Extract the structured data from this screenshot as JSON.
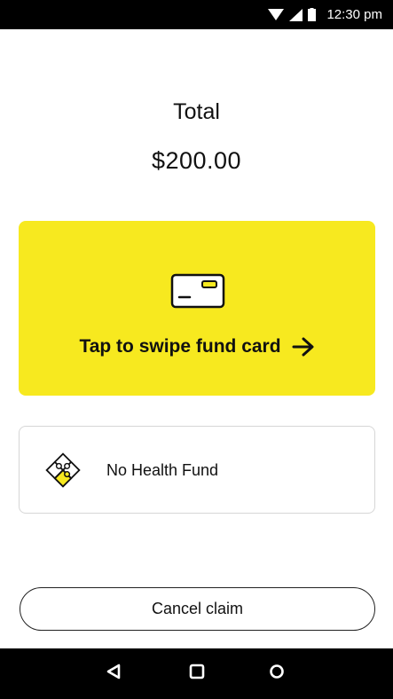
{
  "status_bar": {
    "time": "12:30 pm",
    "icons": [
      "wifi-icon",
      "signal-icon",
      "battery-icon"
    ]
  },
  "total": {
    "label": "Total",
    "amount": "$200.00"
  },
  "swipe_card": {
    "label": "Tap to swipe fund card",
    "icon": "card-icon",
    "arrow_icon": "arrow-right-icon",
    "background_color": "#f7e91f"
  },
  "fund_option": {
    "label": "No Health Fund",
    "icon": "puzzle-icon"
  },
  "cancel": {
    "label": "Cancel claim"
  },
  "nav_bar": {
    "buttons": [
      "back-icon",
      "home-icon",
      "recents-icon"
    ]
  }
}
